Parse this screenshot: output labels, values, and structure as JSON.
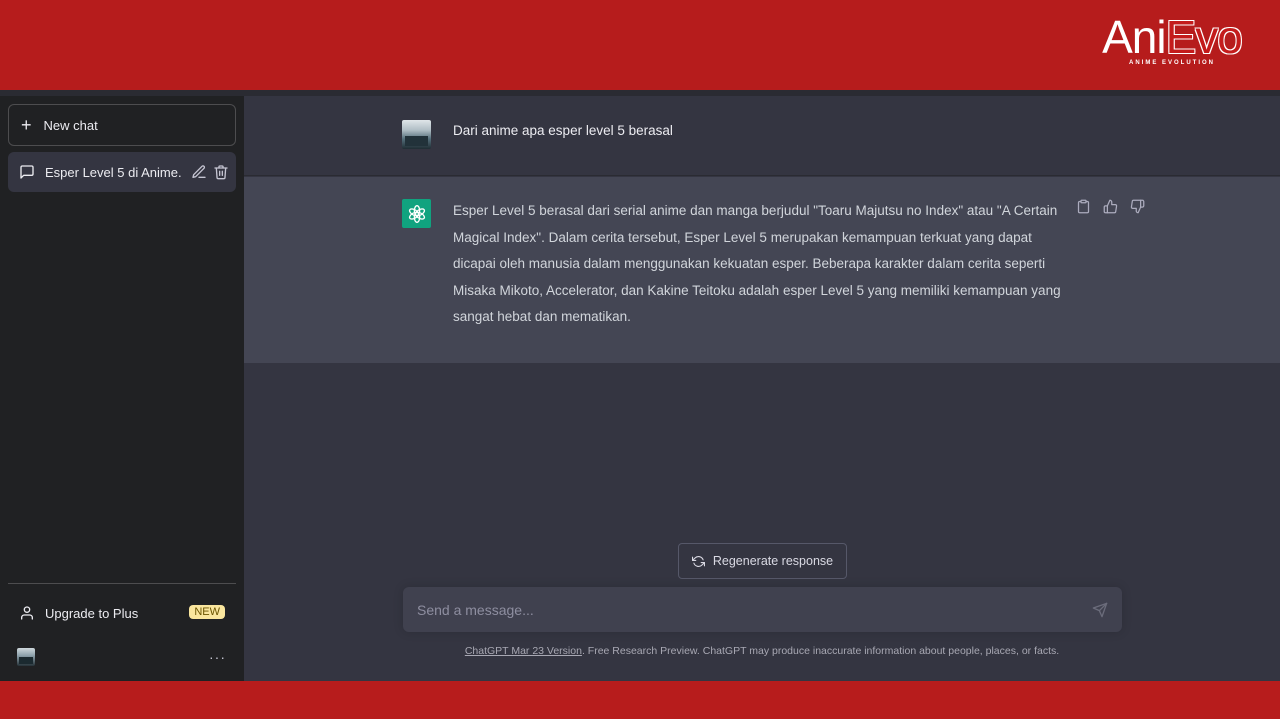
{
  "watermark": {
    "logo_main": "Ani",
    "logo_accent": "Evo",
    "logo_sub": "ANIME EVOLUTION"
  },
  "sidebar": {
    "new_chat_label": "New chat",
    "conversations": [
      {
        "title": "Esper Level 5 di Anime."
      }
    ],
    "upgrade_label": "Upgrade to Plus",
    "new_badge": "NEW",
    "more_label": "···"
  },
  "conversation": {
    "user_message": "Dari anime apa esper level 5 berasal",
    "assistant_message": "Esper Level 5 berasal dari serial anime dan manga berjudul \"Toaru Majutsu no Index\" atau \"A Certain Magical Index\". Dalam cerita tersebut, Esper Level 5 merupakan kemampuan terkuat yang dapat dicapai oleh manusia dalam menggunakan kekuatan esper. Beberapa karakter dalam cerita seperti Misaka Mikoto, Accelerator, dan Kakine Teitoku adalah esper Level 5 yang memiliki kemampuan yang sangat hebat dan mematikan."
  },
  "composer": {
    "regenerate_label": "Regenerate response",
    "placeholder": "Send a message...",
    "footer_link": "ChatGPT Mar 23 Version",
    "footer_text": ". Free Research Preview. ChatGPT may produce inaccurate information about people, places, or facts."
  },
  "colors": {
    "brand_red": "#b71c1c",
    "sidebar_bg": "#202123",
    "main_bg": "#343541",
    "assistant_bg": "#444654",
    "assistant_avatar": "#10a37f",
    "badge": "#fae69e"
  }
}
